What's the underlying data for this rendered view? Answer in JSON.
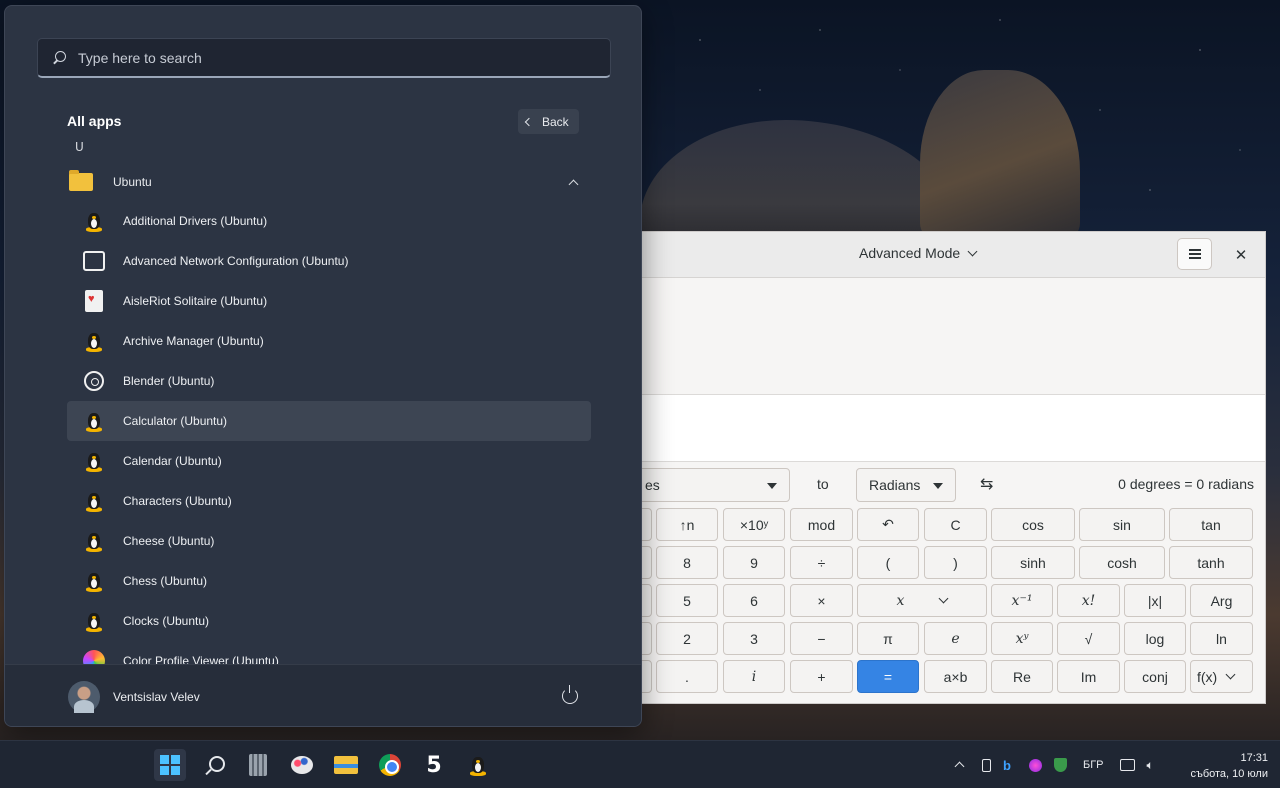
{
  "start_menu": {
    "search": {
      "placeholder": "Type here to search"
    },
    "all_apps_title": "All apps",
    "back_label": "Back",
    "letter": "U",
    "group": {
      "label": "Ubuntu",
      "icon": "folder-icon"
    },
    "apps": [
      {
        "label": "Additional Drivers (Ubuntu)",
        "icon": "tux-icon"
      },
      {
        "label": "Advanced Network Configuration (Ubuntu)",
        "icon": "network-config-icon"
      },
      {
        "label": "AisleRiot Solitaire (Ubuntu)",
        "icon": "cards-icon"
      },
      {
        "label": "Archive Manager (Ubuntu)",
        "icon": "tux-icon"
      },
      {
        "label": "Blender (Ubuntu)",
        "icon": "blender-icon"
      },
      {
        "label": "Calculator (Ubuntu)",
        "icon": "tux-icon",
        "selected": true
      },
      {
        "label": "Calendar (Ubuntu)",
        "icon": "tux-icon"
      },
      {
        "label": "Characters (Ubuntu)",
        "icon": "tux-icon"
      },
      {
        "label": "Cheese (Ubuntu)",
        "icon": "tux-icon"
      },
      {
        "label": "Chess (Ubuntu)",
        "icon": "tux-icon"
      },
      {
        "label": "Clocks (Ubuntu)",
        "icon": "tux-icon"
      },
      {
        "label": "Color Profile Viewer (Ubuntu)",
        "icon": "color-profile-icon"
      }
    ],
    "user_name": "Ventsislav Velev"
  },
  "calculator": {
    "mode_title": "Advanced Mode",
    "from_unit_visible": "es",
    "to_label": "to",
    "to_unit": "Radians",
    "swap_symbol": "⇆",
    "conversion_result": "0 degrees  =  0 radians",
    "keys": {
      "row1": [
        "↑n",
        "×10ʸ",
        "mod",
        "↶",
        "C",
        "cos",
        "sin",
        "tan"
      ],
      "row2": [
        "8",
        "9",
        "÷",
        "(",
        ")",
        "sinh",
        "cosh",
        "tanh"
      ],
      "row3": [
        "5",
        "6",
        "×",
        "x",
        "x⁻¹",
        "x!",
        "|x|",
        "Arg"
      ],
      "row4": [
        "2",
        "3",
        "−",
        "π",
        "e",
        "xʸ",
        "√",
        "log",
        "ln"
      ],
      "row5": [
        ".",
        "i",
        "+",
        "=",
        "a×b",
        "Re",
        "Im",
        "conj",
        "f(x)"
      ]
    }
  },
  "taskbar": {
    "language": "БГР",
    "time": "17:31",
    "date": "събота, 10 юли"
  }
}
